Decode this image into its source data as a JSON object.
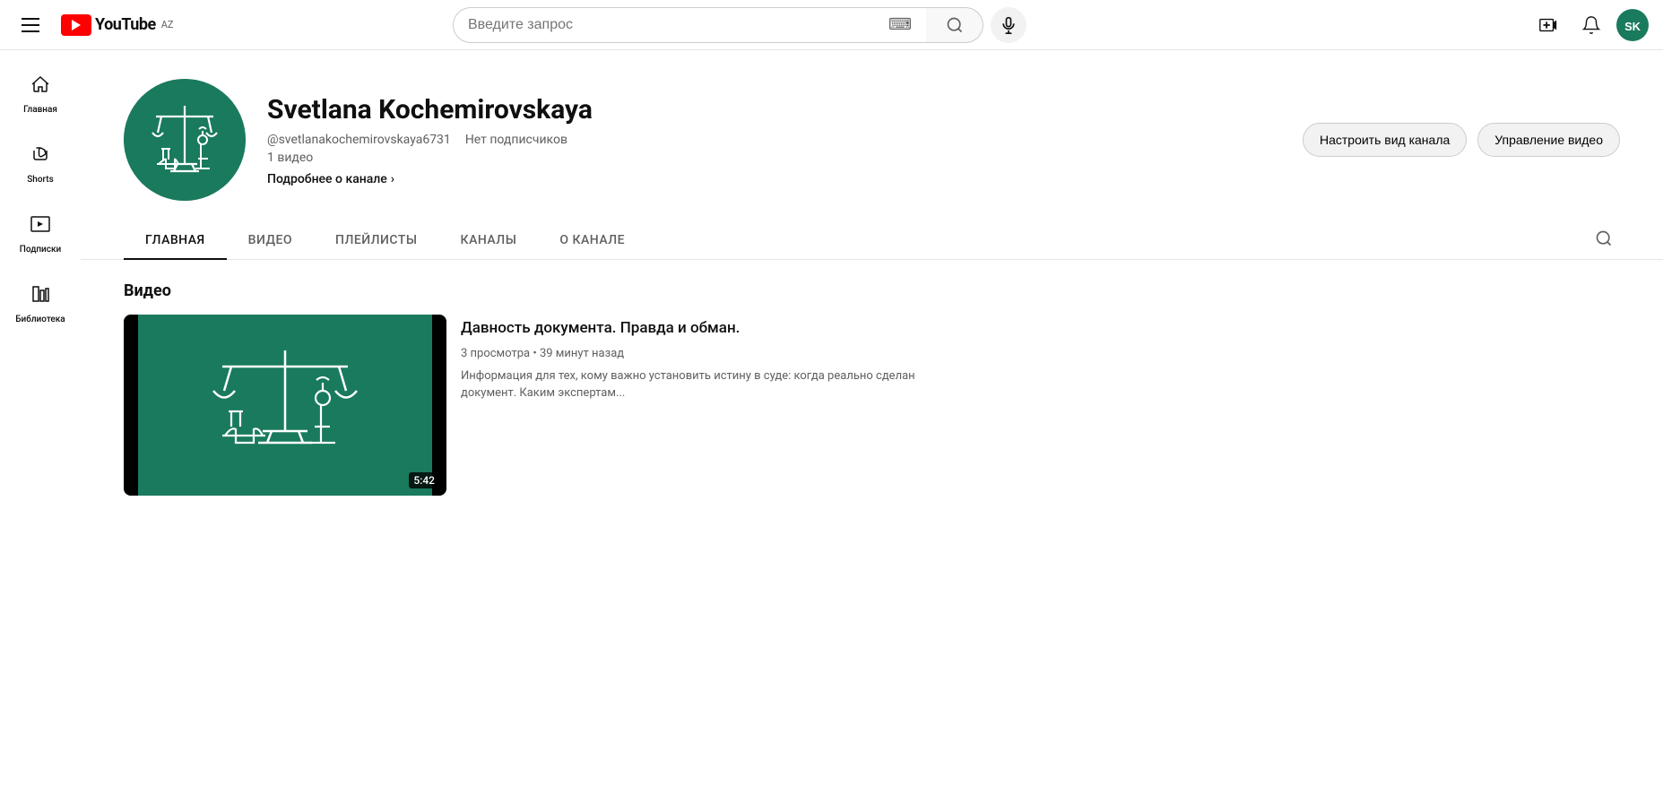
{
  "header": {
    "menu_label": "Menu",
    "logo_text": "YouTube",
    "logo_region": "AZ",
    "search_placeholder": "Введите запрос",
    "mic_label": "Voice search",
    "create_label": "Create",
    "notifications_label": "Notifications",
    "account_label": "Account"
  },
  "sidebar": {
    "items": [
      {
        "id": "home",
        "label": "Главная",
        "icon": "home"
      },
      {
        "id": "shorts",
        "label": "Shorts",
        "icon": "shorts"
      },
      {
        "id": "subscriptions",
        "label": "Подписки",
        "icon": "subscriptions"
      },
      {
        "id": "library",
        "label": "Библиотека",
        "icon": "library"
      }
    ]
  },
  "channel": {
    "name": "Svetlana Kochemirovskaya",
    "handle": "@svetlanakochemirovskaya6731",
    "subscribers": "Нет подписчиков",
    "videos_count": "1 видео",
    "more_label": "Подробнее о канале",
    "actions": {
      "customize": "Настроить вид канала",
      "manage": "Управление видео"
    },
    "nav": {
      "items": [
        {
          "id": "home",
          "label": "ГЛАВНАЯ",
          "active": true
        },
        {
          "id": "videos",
          "label": "ВИДЕО",
          "active": false
        },
        {
          "id": "playlists",
          "label": "ПЛЕЙЛИСТЫ",
          "active": false
        },
        {
          "id": "channels",
          "label": "КАНАЛЫ",
          "active": false
        },
        {
          "id": "about",
          "label": "О КАНАЛЕ",
          "active": false
        }
      ]
    }
  },
  "content": {
    "section_title": "Видео",
    "video": {
      "title": "Давность документа. Правда и обман.",
      "views": "3 просмотра",
      "time": "39 минут назад",
      "description": "Информация для тех, кому важно установить истину в суде: когда реально сделан документ. Каким экспертам...",
      "duration": "5:42"
    }
  }
}
